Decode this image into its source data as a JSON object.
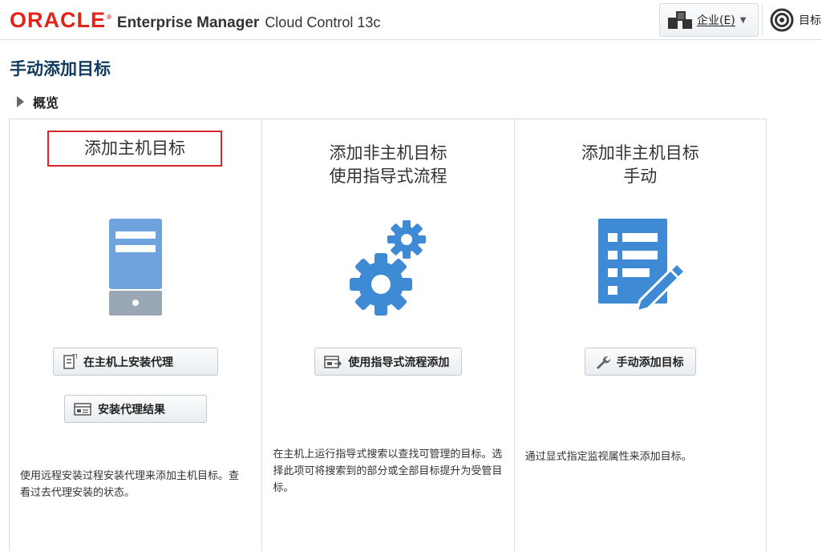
{
  "header": {
    "brand": "ORACLE",
    "product": "Enterprise Manager",
    "product_sub": "Cloud Control 13c",
    "enterprise_menu": "企业(E)",
    "targets_menu": "目标"
  },
  "page": {
    "title": "手动添加目标",
    "overview_label": "概览"
  },
  "panels": [
    {
      "title_lines": [
        "添加主机目标"
      ],
      "buttons": [
        {
          "label": "在主机上安装代理",
          "icon": "install-agent-icon"
        },
        {
          "label": "安装代理结果",
          "icon": "agent-results-icon"
        }
      ],
      "description": "使用远程安装过程安装代理来添加主机目标。查看过去代理安装的状态。",
      "illustration": "server-icon"
    },
    {
      "title_lines": [
        "添加非主机目标",
        "使用指导式流程"
      ],
      "buttons": [
        {
          "label": "使用指导式流程添加",
          "icon": "guided-process-icon"
        }
      ],
      "description": "在主机上运行指导式搜索以查找可管理的目标。选择此项可将搜索到的部分或全部目标提升为受管目标。",
      "illustration": "gears-icon"
    },
    {
      "title_lines": [
        "添加非主机目标",
        "手动"
      ],
      "buttons": [
        {
          "label": "手动添加目标",
          "icon": "wrench-icon"
        }
      ],
      "description": "通过显式指定监视属性来添加目标。",
      "illustration": "document-edit-icon"
    }
  ],
  "colors": {
    "oracle_red": "#e2231a",
    "title_blue": "#103a5f",
    "illustration_blue": "#4a90d9",
    "highlight_red": "#d9262c"
  }
}
